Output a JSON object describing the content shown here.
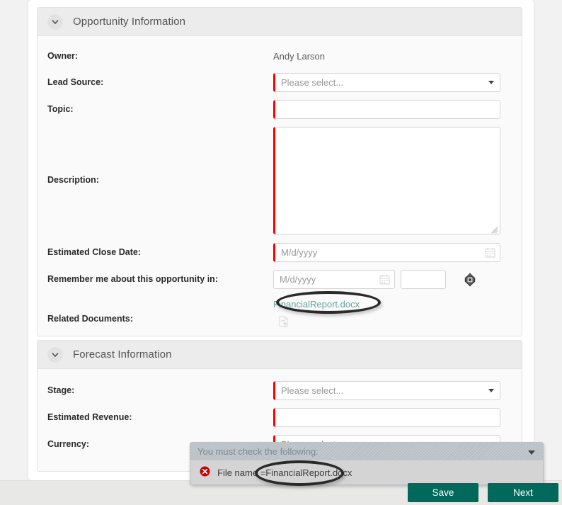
{
  "sections": [
    {
      "id": "opportunity-information",
      "title": "Opportunity Information",
      "collapse_icon": "chevron-down-icon",
      "fields": {
        "owner": {
          "label": "Owner:",
          "value": "Andy Larson"
        },
        "lead_source": {
          "label": "Lead Source:",
          "value": "",
          "placeholder": "Please select...",
          "caret_icon": "chevron-down-icon"
        },
        "topic": {
          "label": "Topic:",
          "value": "",
          "placeholder": ""
        },
        "description": {
          "label": "Description:",
          "value": "",
          "placeholder": ""
        },
        "estimated_close_date": {
          "label": "Estimated Close Date:",
          "value": "",
          "placeholder": "M/d/yyyy",
          "icon": "calendar-icon"
        },
        "remember_me": {
          "label": "Remember me about this opportunity in:",
          "date_value": "",
          "date_placeholder": "M/d/yyyy",
          "date_icon": "calendar-icon",
          "amount_value": "",
          "amount_placeholder": "",
          "stepper_icon": "move-handle-icon"
        },
        "related_documents": {
          "label": "Related Documents:",
          "file_name": "FinancialReport.docx",
          "upload_icon": "document-upload-icon"
        }
      }
    },
    {
      "id": "forecast-information",
      "title": "Forecast Information",
      "collapse_icon": "chevron-down-icon",
      "fields": {
        "stage": {
          "label": "Stage:",
          "value": "",
          "placeholder": "Please select...",
          "caret_icon": "chevron-down-icon"
        },
        "estimated_revenue": {
          "label": "Estimated Revenue:",
          "value": "",
          "placeholder": ""
        },
        "currency": {
          "label": "Currency:",
          "value": "",
          "placeholder": "Please select...",
          "caret_icon": "chevron-down-icon"
        }
      }
    }
  ],
  "validation": {
    "header_text": "You must check the following:",
    "caret_icon": "chevron-down-icon",
    "error_icon": "error-circle-icon",
    "message": "File name =FinancialReport.docx"
  },
  "footer": {
    "save_label": "Save",
    "next_label": "Next"
  },
  "colors": {
    "accent_button": "#00695c",
    "required_marker": "#ff0000",
    "link": "#66a39c",
    "section_header_bg": "#ececec",
    "page_bg": "#f2f2f2",
    "error": "#cc0000"
  },
  "annotations": [
    {
      "name": "annotation-ellipse-file-link"
    },
    {
      "name": "annotation-ellipse-validation-filename"
    }
  ]
}
